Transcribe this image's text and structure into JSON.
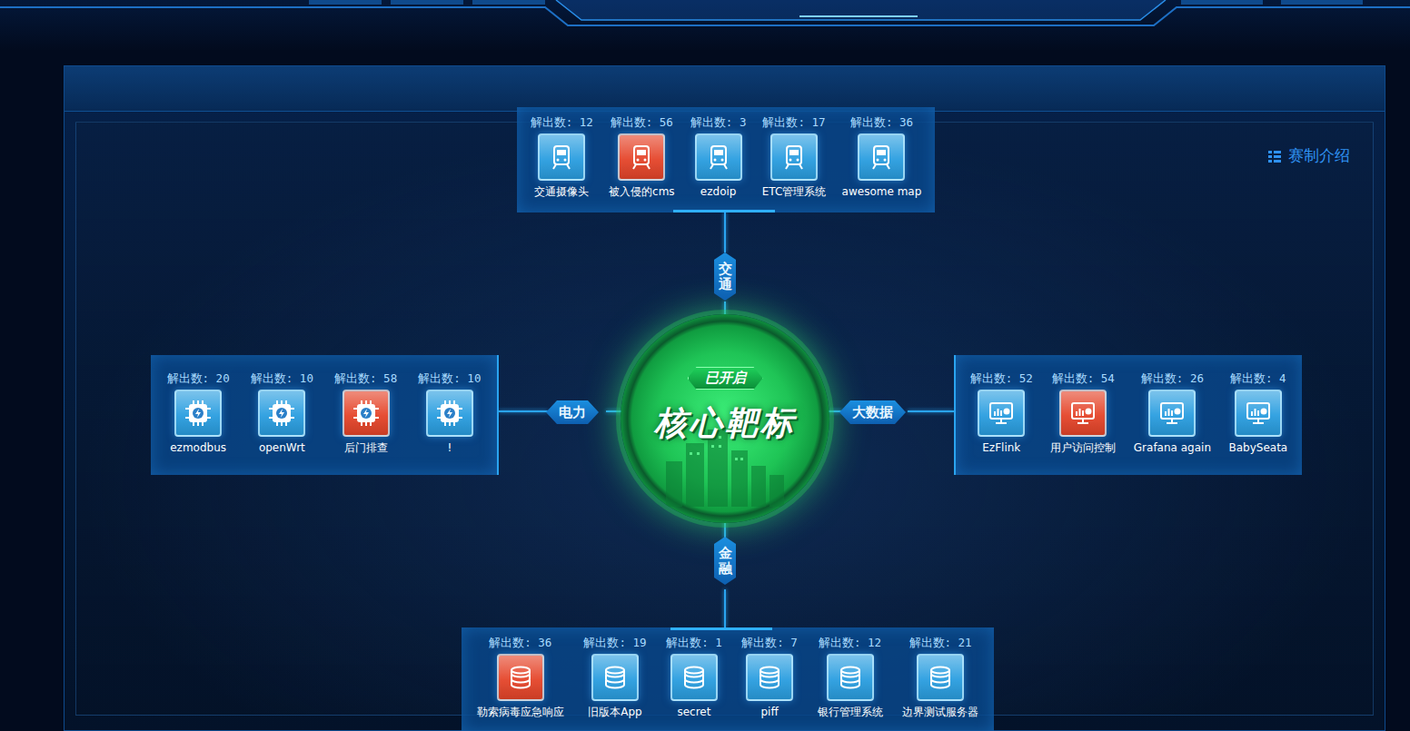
{
  "header": {
    "intro": "赛制介绍"
  },
  "core": {
    "status": "已开启",
    "title": "核心靶标"
  },
  "sectors": [
    {
      "label": "交通",
      "kind": "train",
      "challenges": [
        {
          "solves": "解出数: 12",
          "name": "交通摄像头",
          "color": "#2a9ee0"
        },
        {
          "solves": "解出数: 56",
          "name": "被入侵的cms",
          "color": "#e5452a"
        },
        {
          "solves": "解出数: 3",
          "name": "ezdoip",
          "color": "#2a9ee0"
        },
        {
          "solves": "解出数: 17",
          "name": "ETC管理系统",
          "color": "#2a9ee0"
        },
        {
          "solves": "解出数: 36",
          "name": "awesome map",
          "color": "#2a9ee0"
        }
      ]
    },
    {
      "label": "电力",
      "kind": "chip",
      "challenges": [
        {
          "solves": "解出数: 20",
          "name": "ezmodbus",
          "color": "#2a9ee0"
        },
        {
          "solves": "解出数: 10",
          "name": "openWrt",
          "color": "#2a9ee0"
        },
        {
          "solves": "解出数: 58",
          "name": "后门排查",
          "color": "#e5452a"
        },
        {
          "solves": "解出数: 10",
          "name": "!",
          "color": "#2a9ee0"
        }
      ]
    },
    {
      "label": "大数据",
      "kind": "monitor",
      "challenges": [
        {
          "solves": "解出数: 52",
          "name": "EzFlink",
          "color": "#2a9ee0"
        },
        {
          "solves": "解出数: 54",
          "name": "用户访问控制",
          "color": "#e5452a"
        },
        {
          "solves": "解出数: 26",
          "name": "Grafana again",
          "color": "#2a9ee0"
        },
        {
          "solves": "解出数: 4",
          "name": "BabySeata",
          "color": "#2a9ee0"
        }
      ]
    },
    {
      "label": "金融",
      "kind": "coins",
      "challenges": [
        {
          "solves": "解出数: 36",
          "name": "勒索病毒应急响应",
          "color": "#e5452a"
        },
        {
          "solves": "解出数: 19",
          "name": "旧版本App",
          "color": "#2a9ee0"
        },
        {
          "solves": "解出数: 1",
          "name": "secret",
          "color": "#2a9ee0"
        },
        {
          "solves": "解出数: 7",
          "name": "piff",
          "color": "#2a9ee0"
        },
        {
          "solves": "解出数: 12",
          "name": "银行管理系统",
          "color": "#2a9ee0"
        },
        {
          "solves": "解出数: 21",
          "name": "边界测试服务器",
          "color": "#2a9ee0"
        }
      ]
    }
  ]
}
